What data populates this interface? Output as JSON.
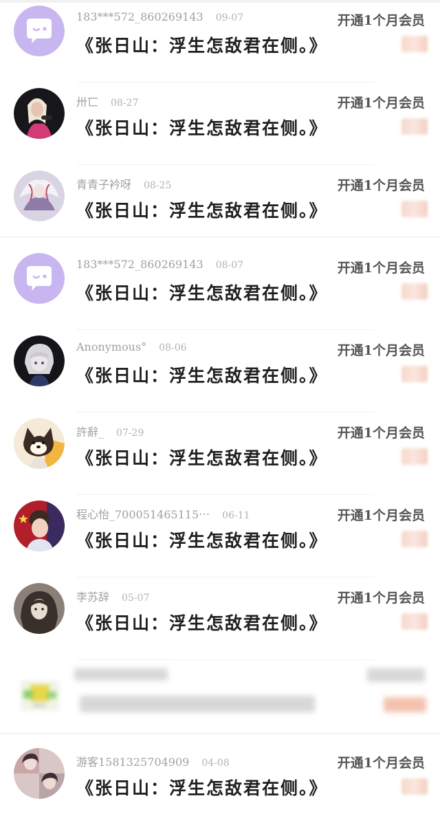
{
  "colors": {
    "title": "#1f1f1f",
    "username": "#a0a0a0",
    "date": "#b2b2b2",
    "action": "#555555",
    "price_blur": "#f6d8cc",
    "default_avatar": "#c7b6ef"
  },
  "comments": [
    {
      "username": "183***572_860269143",
      "date": "09-07",
      "title": "《张日山：浮生怎敌君在侧。》",
      "action": "开通1个月会员",
      "avatar": "default-chat-avatar"
    },
    {
      "username": "卅匸",
      "date": "08-27",
      "title": "《张日山：浮生怎敌君在侧。》",
      "action": "开通1个月会员",
      "avatar": "photo-avatar"
    },
    {
      "username": "青青子衿呀",
      "date": "08-25",
      "title": "《张日山：浮生怎敌君在侧。》",
      "action": "开通1个月会员",
      "avatar": "illustration-avatar"
    },
    {
      "username": "183***572_860269143",
      "date": "08-07",
      "title": "《张日山：浮生怎敌君在侧。》",
      "action": "开通1个月会员",
      "avatar": "default-chat-avatar"
    },
    {
      "username": "Anonymous°",
      "date": "08-06",
      "title": "《张日山：浮生怎敌君在侧。》",
      "action": "开通1个月会员",
      "avatar": "anime-avatar"
    },
    {
      "username": "許辭_",
      "date": "07-29",
      "title": "《张日山：浮生怎敌君在侧。》",
      "action": "开通1个月会员",
      "avatar": "dog-avatar"
    },
    {
      "username": "程心怡_700051465115⋯",
      "date": "06-11",
      "title": "《张日山：浮生怎敌君在侧。》",
      "action": "开通1个月会员",
      "avatar": "portrait-avatar"
    },
    {
      "username": "李苏辞",
      "date": "05-07",
      "title": "《张日山：浮生怎敌君在侧。》",
      "action": "开通1个月会员",
      "avatar": "sketch-avatar"
    },
    {
      "username": "游客1581325704909",
      "date": "04-08",
      "title": "《张日山：浮生怎敌君在侧。》",
      "action": "开通1个月会员",
      "avatar": "collage-avatar"
    }
  ]
}
